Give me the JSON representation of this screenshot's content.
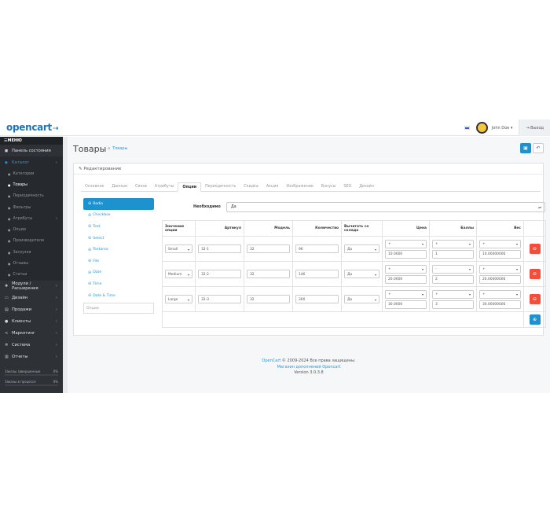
{
  "header": {
    "logo": "opencart",
    "logo_cart": "⇢",
    "user_name": "John Doe",
    "logout_label": "Выход"
  },
  "sidebar": {
    "menu_label": "МЕНЮ",
    "items": [
      {
        "label": "Панель состояния",
        "icon": "dashboard-icon",
        "glyph": "◼",
        "active": false,
        "has_arrow": false
      },
      {
        "label": "Каталог",
        "icon": "tag-icon",
        "glyph": "◆",
        "active": true,
        "has_arrow": true
      }
    ],
    "catalog_sub": [
      {
        "label": "Категории",
        "active": false
      },
      {
        "label": "Товары",
        "active": true
      },
      {
        "label": "Периодичность",
        "active": false
      },
      {
        "label": "Фильтры",
        "active": false
      },
      {
        "label": "Атрибуты",
        "active": false,
        "has_arrow": true
      },
      {
        "label": "Опции",
        "active": false
      },
      {
        "label": "Производители",
        "active": false
      },
      {
        "label": "Загрузки",
        "active": false
      },
      {
        "label": "Отзывы",
        "active": false
      },
      {
        "label": "Статьи",
        "active": false
      }
    ],
    "items_after": [
      {
        "label": "Модули / Расширения",
        "icon": "puzzle-icon",
        "glyph": "✚"
      },
      {
        "label": "Дизайн",
        "icon": "monitor-icon",
        "glyph": "▭"
      },
      {
        "label": "Продажи",
        "icon": "cart-icon",
        "glyph": "▤"
      },
      {
        "label": "Клиенты",
        "icon": "user-icon",
        "glyph": "●"
      },
      {
        "label": "Маркетинг",
        "icon": "share-icon",
        "glyph": "≺"
      },
      {
        "label": "Система",
        "icon": "gear-icon",
        "glyph": "✲"
      },
      {
        "label": "Отчеты",
        "icon": "chart-icon",
        "glyph": "▥"
      }
    ],
    "stats": [
      {
        "label": "Заказы завершенные",
        "value": "0%"
      },
      {
        "label": "Заказы в процессе",
        "value": "0%"
      }
    ]
  },
  "page": {
    "title": "Товары",
    "breadcrumb": "Товары",
    "panel_title": "Редактирование"
  },
  "tabs": [
    "Основное",
    "Данные",
    "Связи",
    "Атрибуты",
    "Опции",
    "Периодичность",
    "Скидка",
    "Акция",
    "Изображение",
    "Бонусы",
    "SEO",
    "Дизайн"
  ],
  "active_tab": 4,
  "options": [
    {
      "label": "Radio",
      "active": true
    },
    {
      "label": "Checkbox",
      "active": false
    },
    {
      "label": "Text",
      "active": false
    },
    {
      "label": "Select",
      "active": false
    },
    {
      "label": "Textarea",
      "active": false
    },
    {
      "label": "File",
      "active": false
    },
    {
      "label": "Date",
      "active": false
    },
    {
      "label": "Time",
      "active": false
    },
    {
      "label": "Date & Time",
      "active": false
    }
  ],
  "option_input_placeholder": "Опции",
  "required": {
    "label": "Необходимо",
    "value": "Да"
  },
  "table": {
    "headers": [
      "Значение опции",
      "Артикул",
      "Модель",
      "Количество",
      "Вычитать со склада",
      "Цена",
      "Баллы",
      "Вес"
    ],
    "rows": [
      {
        "value": "Small",
        "sku": "32-1",
        "model": "32",
        "qty": "96",
        "subtract": "Да",
        "price_prefix": "+",
        "price": "10.0000",
        "points_prefix": "+",
        "points": "1",
        "weight_prefix": "+",
        "weight": "10.00000000"
      },
      {
        "value": "Medium",
        "sku": "32-2",
        "model": "32",
        "qty": "146",
        "subtract": "Да",
        "price_prefix": "+",
        "price": "20.0000",
        "points_prefix": "-",
        "points": "2",
        "weight_prefix": "+",
        "weight": "20.00000000"
      },
      {
        "value": "Large",
        "sku": "32-3",
        "model": "32",
        "qty": "300",
        "subtract": "Да",
        "price_prefix": "+",
        "price": "30.0000",
        "points_prefix": "+",
        "points": "3",
        "weight_prefix": "+",
        "weight": "30.00000000"
      }
    ]
  },
  "footer": {
    "line1_link": "OpenCart",
    "line1_text": " © 2009-2024 Все права защищены.",
    "line2": "Магазин дополнений Opencart",
    "line3": "Version 3.0.3.8"
  },
  "colors": {
    "accent": "#1e91cf",
    "danger": "#f44d3b",
    "sidebar": "#2e3237"
  }
}
